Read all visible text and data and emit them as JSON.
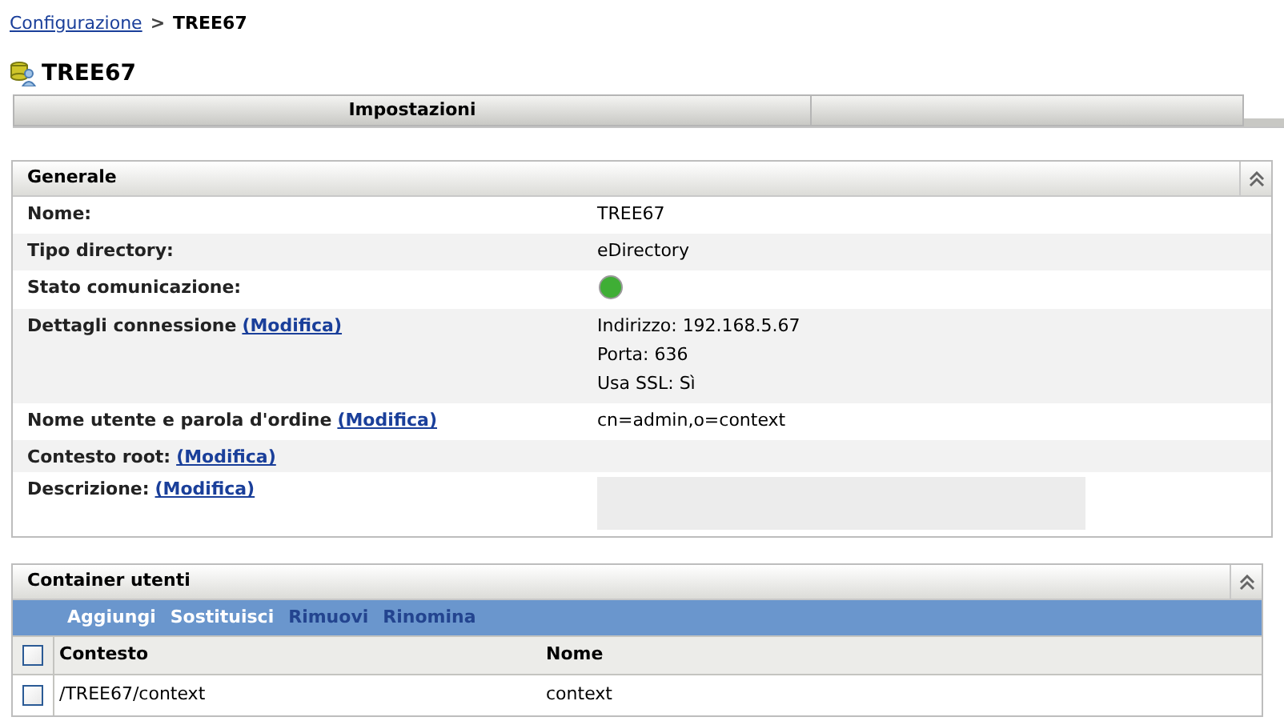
{
  "breadcrumb": {
    "link": "Configurazione",
    "separator": ">",
    "current": "TREE67"
  },
  "title": "TREE67",
  "tabs": [
    {
      "label": "Impostazioni",
      "selected": true
    }
  ],
  "general": {
    "title": "Generale",
    "expanded": true,
    "rows": [
      {
        "kind": "text",
        "label": "Nome:",
        "values": [
          "TREE67"
        ]
      },
      {
        "kind": "text",
        "label": "Tipo directory:",
        "values": [
          "eDirectory"
        ]
      },
      {
        "kind": "status",
        "label": "Stato comunicazione:",
        "color": "#3fae35"
      },
      {
        "kind": "text",
        "label": "Dettagli connessione",
        "link": "(Modifica)",
        "values": [
          "Indirizzo: 192.168.5.67",
          "Porta: 636",
          "Usa SSL: Sì"
        ]
      },
      {
        "kind": "text",
        "label": "Nome utente e parola d'ordine",
        "link": "(Modifica)",
        "values": [
          "cn=admin,o=context"
        ]
      },
      {
        "kind": "text",
        "label": "Contesto root:",
        "link": "(Modifica)",
        "values": []
      },
      {
        "kind": "textarea",
        "label": "Descrizione:",
        "link": "(Modifica)"
      }
    ]
  },
  "containers": {
    "title": "Container utenti",
    "expanded": true,
    "actions": [
      {
        "label": "Aggiungi",
        "disabled": false
      },
      {
        "label": "Sostituisci",
        "disabled": false
      },
      {
        "label": "Rimuovi",
        "disabled": true
      },
      {
        "label": "Rinomina",
        "disabled": true
      }
    ],
    "columns": [
      "Contesto",
      "Nome"
    ],
    "select_all_checked": false,
    "rows": [
      {
        "checked": false,
        "cells": [
          "/TREE67/context",
          "context"
        ]
      }
    ]
  }
}
